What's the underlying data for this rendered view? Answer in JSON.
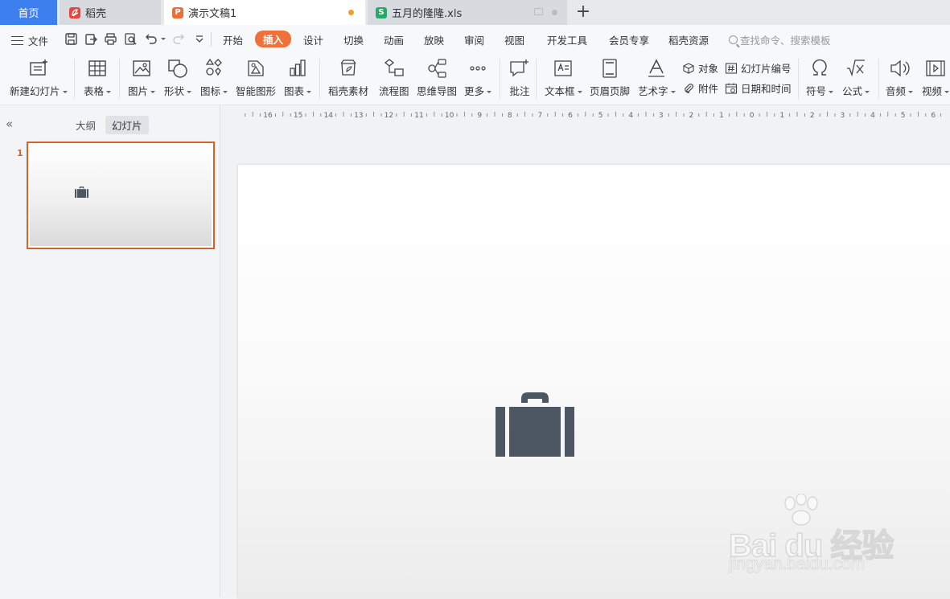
{
  "tabs": {
    "home": "首页",
    "docer": "稻壳",
    "presentation": "演示文稿1",
    "spreadsheet": "五月的隆隆.xls",
    "new_tab": "+"
  },
  "menu": {
    "file": "文件",
    "tabs": [
      "开始",
      "插入",
      "设计",
      "切换",
      "动画",
      "放映",
      "审阅",
      "视图",
      "开发工具",
      "会员专享",
      "稻壳资源"
    ],
    "active_tab": "插入",
    "search_placeholder": "查找命令、搜索模板"
  },
  "ribbon": {
    "new_slide": "新建幻灯片",
    "table": "表格",
    "picture": "图片",
    "shape": "形状",
    "icon": "图标",
    "smartart": "智能图形",
    "chart": "图表",
    "docer_material": "稻壳素材",
    "flowchart": "流程图",
    "mindmap": "思维导图",
    "more": "更多",
    "comment": "批注",
    "textbox": "文本框",
    "header_footer": "页眉页脚",
    "wordart": "艺术字",
    "object": "对象",
    "attachment": "附件",
    "slide_number": "幻灯片编号",
    "date_time": "日期和时间",
    "symbol": "符号",
    "equation": "公式",
    "audio": "音频",
    "video": "视频"
  },
  "left_panel": {
    "outline_tab": "大纲",
    "slides_tab": "幻灯片",
    "slide_number": "1"
  },
  "ruler": {
    "labels": [
      "16",
      "15",
      "14",
      "13",
      "12",
      "11",
      "10",
      "9",
      "8",
      "7",
      "6",
      "5",
      "4",
      "3",
      "2",
      "1",
      "0",
      "1",
      "2",
      "3",
      "4",
      "5",
      "6"
    ]
  },
  "slide": {
    "icon": "briefcase-icon"
  },
  "watermark": {
    "brand": "Bai du 经验",
    "url": "jingyan.baidu.com"
  },
  "colors": {
    "home_tab": "#3e7ff0",
    "accent": "#ef7039",
    "selected_slide_border": "#d0652c",
    "briefcase": "#4d5663"
  }
}
